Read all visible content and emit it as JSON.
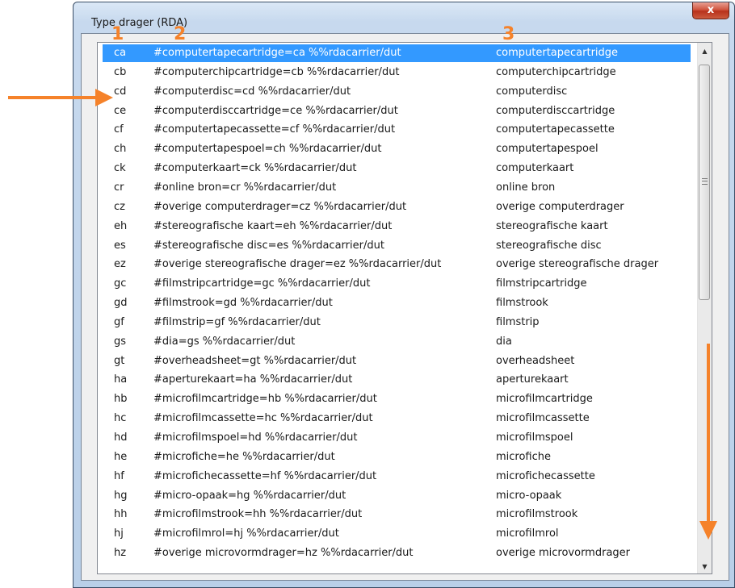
{
  "window": {
    "title": "Type drager (RDA)",
    "close_label": "x"
  },
  "annotations": {
    "col1": "1",
    "col2": "2",
    "col3": "3",
    "accent_color": "#f5822a"
  },
  "selected_row": 0,
  "rows": [
    {
      "code": "ca",
      "definition": "#computertapecartridge=ca %%rdacarrier/dut",
      "label": "computertapecartridge"
    },
    {
      "code": "cb",
      "definition": "#computerchipcartridge=cb %%rdacarrier/dut",
      "label": "computerchipcartridge"
    },
    {
      "code": "cd",
      "definition": "#computerdisc=cd %%rdacarrier/dut",
      "label": "computerdisc"
    },
    {
      "code": "ce",
      "definition": "#computerdisccartridge=ce %%rdacarrier/dut",
      "label": "computerdisccartridge"
    },
    {
      "code": "cf",
      "definition": "#computertapecassette=cf %%rdacarrier/dut",
      "label": "computertapecassette"
    },
    {
      "code": "ch",
      "definition": "#computertapespoel=ch %%rdacarrier/dut",
      "label": "computertapespoel"
    },
    {
      "code": "ck",
      "definition": "#computerkaart=ck %%rdacarrier/dut",
      "label": "computerkaart"
    },
    {
      "code": "cr",
      "definition": "#online bron=cr %%rdacarrier/dut",
      "label": "online bron"
    },
    {
      "code": "cz",
      "definition": "#overige computerdrager=cz %%rdacarrier/dut",
      "label": "overige computerdrager"
    },
    {
      "code": "eh",
      "definition": "#stereografische kaart=eh %%rdacarrier/dut",
      "label": "stereografische kaart"
    },
    {
      "code": "es",
      "definition": "#stereografische disc=es %%rdacarrier/dut",
      "label": "stereografische disc"
    },
    {
      "code": "ez",
      "definition": "#overige stereografische drager=ez %%rdacarrier/dut",
      "label": "overige stereografische drager"
    },
    {
      "code": "gc",
      "definition": "#filmstripcartridge=gc %%rdacarrier/dut",
      "label": "filmstripcartridge"
    },
    {
      "code": "gd",
      "definition": "#filmstrook=gd %%rdacarrier/dut",
      "label": "filmstrook"
    },
    {
      "code": "gf",
      "definition": "#filmstrip=gf %%rdacarrier/dut",
      "label": "filmstrip"
    },
    {
      "code": "gs",
      "definition": "#dia=gs %%rdacarrier/dut",
      "label": "dia"
    },
    {
      "code": "gt",
      "definition": "#overheadsheet=gt %%rdacarrier/dut",
      "label": "overheadsheet"
    },
    {
      "code": "ha",
      "definition": "#aperturekaart=ha %%rdacarrier/dut",
      "label": "aperturekaart"
    },
    {
      "code": "hb",
      "definition": "#microfilmcartridge=hb %%rdacarrier/dut",
      "label": "microfilmcartridge"
    },
    {
      "code": "hc",
      "definition": "#microfilmcassette=hc %%rdacarrier/dut",
      "label": "microfilmcassette"
    },
    {
      "code": "hd",
      "definition": "#microfilmspoel=hd %%rdacarrier/dut",
      "label": "microfilmspoel"
    },
    {
      "code": "he",
      "definition": "#microfiche=he %%rdacarrier/dut",
      "label": "microfiche"
    },
    {
      "code": "hf",
      "definition": "#microfichecassette=hf %%rdacarrier/dut",
      "label": "microfichecassette"
    },
    {
      "code": "hg",
      "definition": "#micro-opaak=hg %%rdacarrier/dut",
      "label": "micro-opaak"
    },
    {
      "code": "hh",
      "definition": "#microfilmstrook=hh %%rdacarrier/dut",
      "label": "microfilmstrook"
    },
    {
      "code": "hj",
      "definition": "#microfilmrol=hj %%rdacarrier/dut",
      "label": "microfilmrol"
    },
    {
      "code": "hz",
      "definition": "#overige microvormdrager=hz %%rdacarrier/dut",
      "label": "overige microvormdrager"
    }
  ]
}
